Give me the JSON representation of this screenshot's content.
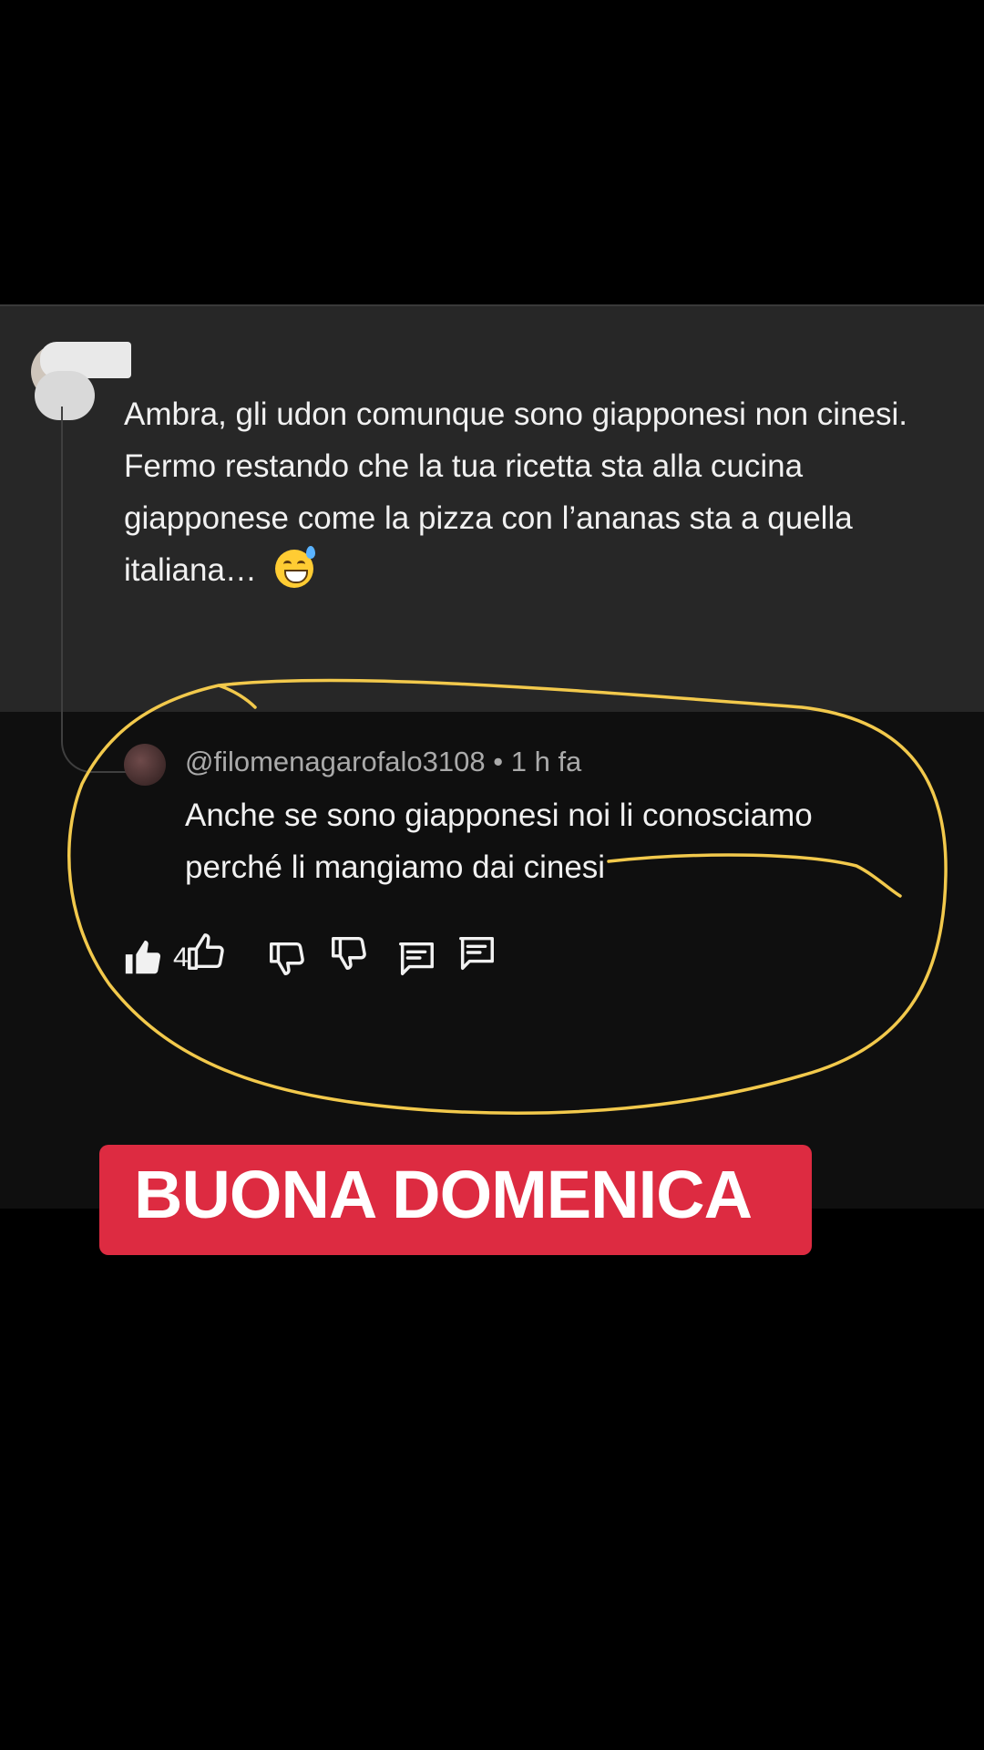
{
  "comment": {
    "text": "Ambra, gli udon comunque sono giapponesi non cinesi. Fermo restando che la tua ricetta sta alla cucina giapponese come la pizza con l’ananas sta a quella italiana…",
    "emoji_icon": "grinning-face-with-sweat-icon",
    "like_count": "4",
    "like_icon": "thumbs-up-filled-icon",
    "dislike_icon": "thumbs-down-icon",
    "reply_icon": "comment-reply-icon"
  },
  "reply": {
    "handle": "@filomenagarofalo3108",
    "separator": " • ",
    "time": "1 h fa",
    "text": "Anche se sono giapponesi noi li conosciamo perché li mangiamo dai cinesi",
    "like_icon": "thumbs-up-outline-icon",
    "dislike_icon": "thumbs-down-icon",
    "reply_icon": "comment-reply-icon"
  },
  "banner": {
    "text": "BUONA DOMENICA",
    "color": "#dd2b41"
  },
  "colors": {
    "annotation": "#f2c94c",
    "top_comment_bg": "#272727",
    "screen_bg": "#0f0f0f"
  }
}
